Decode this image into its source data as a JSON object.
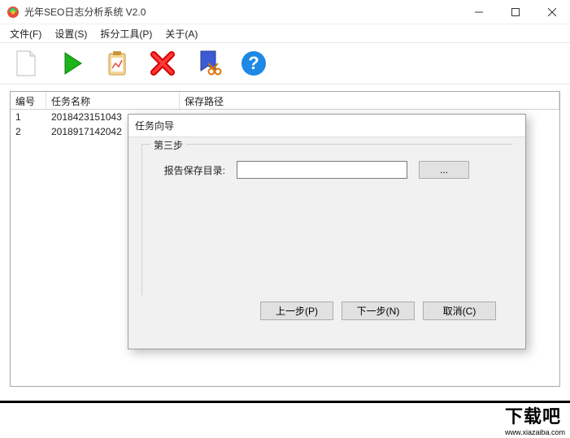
{
  "window": {
    "title": "光年SEO日志分析系统 V2.0"
  },
  "menu": {
    "file": "文件(F)",
    "settings": "设置(S)",
    "split_tools": "拆分工具(P)",
    "about": "关于(A)"
  },
  "table": {
    "headers": {
      "id": "编号",
      "task_name": "任务名称",
      "save_path": "保存路径"
    },
    "rows": [
      {
        "id": "1",
        "task_name": "2018423151043",
        "save_path": ""
      },
      {
        "id": "2",
        "task_name": "2018917142042",
        "save_path": ""
      }
    ]
  },
  "dialog": {
    "title": "任务向导",
    "step_label": "第三步",
    "save_dir_label": "报告保存目录:",
    "save_dir_value": "",
    "browse_label": "...",
    "prev": "上一步(P)",
    "next": "下一步(N)",
    "cancel": "取消(C)"
  },
  "watermark": {
    "text": "下载吧",
    "site": "www.xiazaiba.com"
  }
}
